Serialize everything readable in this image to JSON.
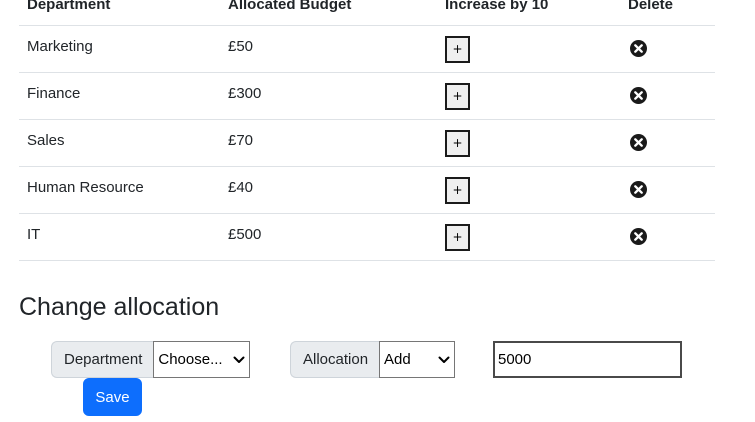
{
  "table": {
    "headers": {
      "department": "Department",
      "budget": "Allocated Budget",
      "increase": "Increase by 10",
      "delete": "Delete"
    },
    "rows": [
      {
        "department": "Marketing",
        "budget": "£50",
        "increase_label": "+"
      },
      {
        "department": "Finance",
        "budget": "£300",
        "increase_label": "+"
      },
      {
        "department": "Sales",
        "budget": "£70",
        "increase_label": "+"
      },
      {
        "department": "Human Resource",
        "budget": "£40",
        "increase_label": "+"
      },
      {
        "department": "IT",
        "budget": "£500",
        "increase_label": "+"
      }
    ]
  },
  "form": {
    "title": "Change allocation",
    "department_label": "Department",
    "department_select_value": "Choose...",
    "allocation_label": "Allocation",
    "allocation_select_value": "Add",
    "amount_value": "5000",
    "save_label": "Save"
  },
  "colors": {
    "primary": "#0d6efd",
    "addon_bg": "#e9ecef",
    "border": "#dee2e6"
  },
  "icons": {
    "delete": "x-circle-icon",
    "select": "chevron-down-icon"
  }
}
